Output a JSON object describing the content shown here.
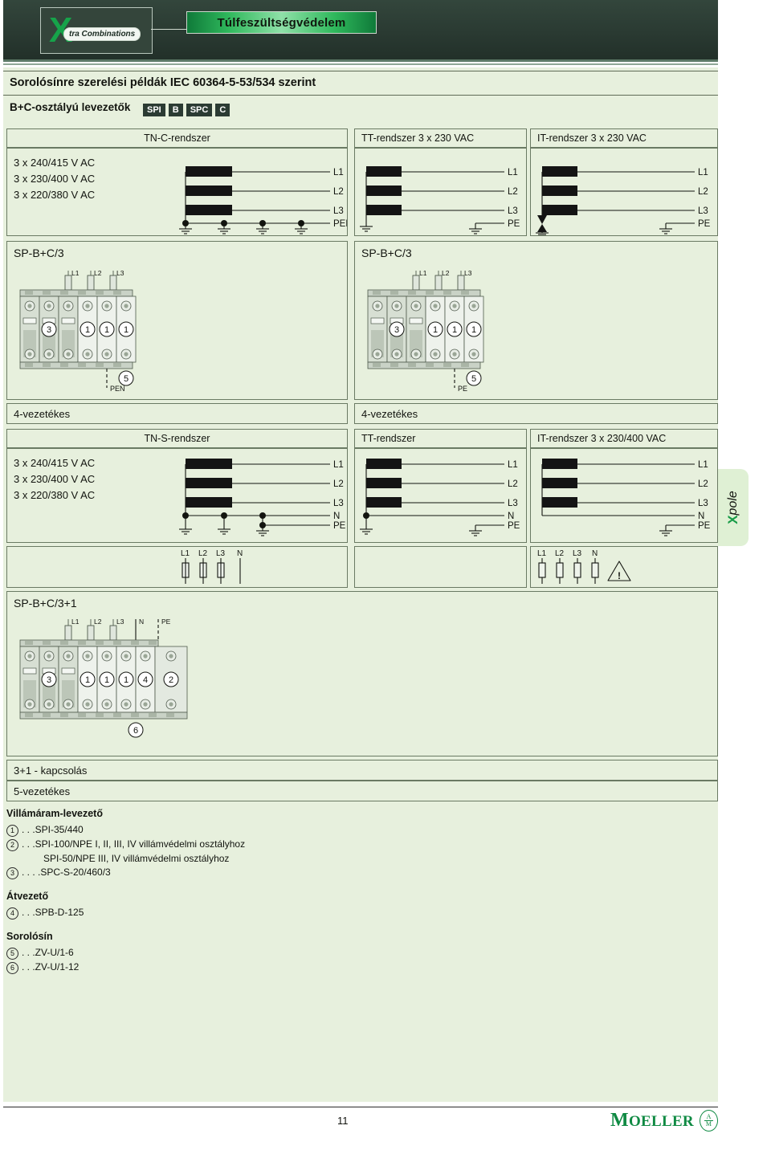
{
  "header": {
    "logo_x": "X",
    "logo_text": "tra Combinations",
    "title": "Túlfeszültségvédelem"
  },
  "headlines": {
    "line1": "Sorolósínre szerelési példák IEC 60364-5-53/534 szerint",
    "line2": "B+C-osztályú levezetők",
    "badges": [
      "SPI",
      "B",
      "SPC",
      "C"
    ]
  },
  "voltages": [
    "3 x 240/415 V AC",
    "3 x 230/400 V AC",
    "3 x 220/380 V AC"
  ],
  "row1": {
    "headers": [
      "TN-C-rendszer",
      "TT-rendszer 3 x 230 VAC",
      "IT-rendszer 3 x 230 VAC"
    ],
    "conductors_tnc": [
      "L1",
      "L2",
      "L3",
      "PEN"
    ],
    "conductors_tt": [
      "L1",
      "L2",
      "L3",
      "PE"
    ],
    "conductors_it": [
      "L1",
      "L2",
      "L3",
      "PE"
    ]
  },
  "modules_row1": {
    "left_title": "SP-B+C/3",
    "right_title": "SP-B+C/3",
    "phase_labels": [
      "L1",
      "L2",
      "L3"
    ],
    "circles": [
      "3",
      "1",
      "1",
      "1"
    ],
    "left_rail_num": "5",
    "left_rail_label": "PEN",
    "right_rail_num": "5",
    "right_rail_label": "PE"
  },
  "wire_count_row": {
    "left": "4-vezetékes",
    "right": "4-vezetékes"
  },
  "row2": {
    "headers": [
      "TN-S-rendszer",
      "TT-rendszer",
      "IT-rendszer 3 x 230/400 VAC"
    ],
    "conductors_tns": [
      "L1",
      "L2",
      "L3",
      "N",
      "PE"
    ],
    "conductors_tt": [
      "L1",
      "L2",
      "L3",
      "N",
      "PE"
    ],
    "conductors_it": [
      "L1",
      "L2",
      "L3",
      "N",
      "PE"
    ]
  },
  "fuse_row": {
    "left_labels": [
      "L1",
      "L2",
      "L3",
      "N"
    ],
    "right_labels": [
      "L1",
      "L2",
      "L3",
      "N"
    ],
    "warning_glyph": "!"
  },
  "module_row2": {
    "title": "SP-B+C/3+1",
    "terminal_labels": [
      "L1",
      "L2",
      "L3",
      "N",
      "PE"
    ],
    "circles": [
      "3",
      "1",
      "1",
      "1",
      "4",
      "2"
    ],
    "rail_num": "6"
  },
  "summary": {
    "line1": "3+1 - kapcsolás",
    "line2": "5-vezetékes"
  },
  "legend": {
    "group1_title": "Villámáram-levezető",
    "g1_items": [
      {
        "num": "1",
        "text": ". . .SPI-35/440"
      },
      {
        "num": "2",
        "text": ". . .SPI-100/NPE I, II, III, IV villámvédelmi osztályhoz"
      },
      {
        "num": "3",
        "text": ". . . .SPC-S-20/460/3"
      }
    ],
    "g1_sub": "SPI-50/NPE III, IV villámvédelmi osztályhoz",
    "group2_title": "Átvezető",
    "g2_items": [
      {
        "num": "4",
        "text": ". . .SPB-D-125"
      }
    ],
    "group3_title": "Sorolósín",
    "g3_items": [
      {
        "num": "5",
        "text": ". . .ZV-U/1-6"
      },
      {
        "num": "6",
        "text": ". . .ZV-U/1-12"
      }
    ]
  },
  "side_tab": {
    "x": "X",
    "pole": "pole"
  },
  "footer": {
    "page_number": "11",
    "brand_cap": "M",
    "brand_rest": "OELLER",
    "mark_top": "A",
    "mark_bottom": "M"
  },
  "colors": {
    "brand_green": "#16a34a",
    "header_dark": "#2b3b33",
    "page_bg": "#e7f0dd",
    "moeller_green": "#0f8a43"
  }
}
